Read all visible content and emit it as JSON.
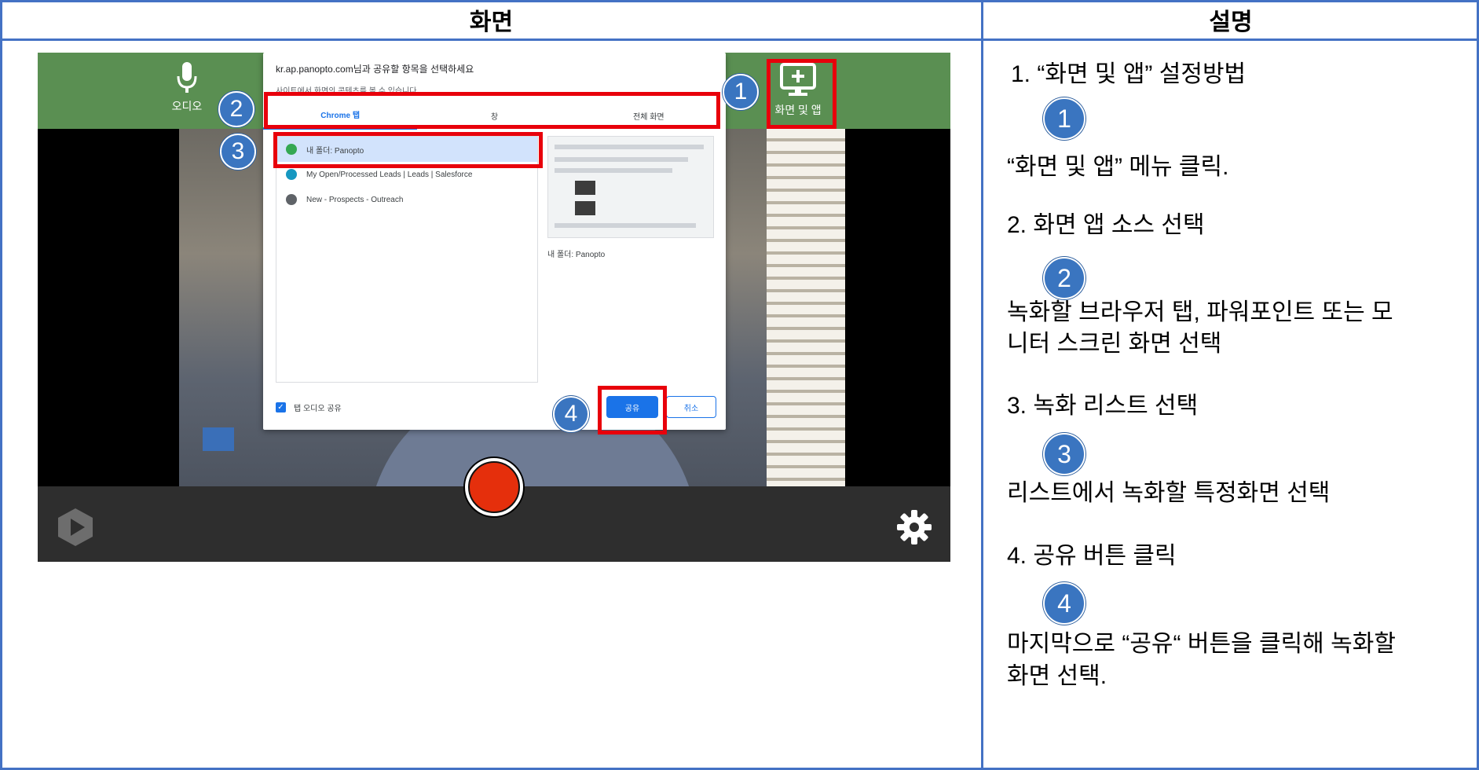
{
  "headers": {
    "left": "화면",
    "right": "설명"
  },
  "screen": {
    "audio_label": "오디오",
    "screen_app_label": "화면 및 앱",
    "dialog": {
      "title": "kr.ap.panopto.com님과 공유할 항목을 선택하세요",
      "subtitle": "사이트에서 화면의 콘텐츠를 볼 수 있습니다.",
      "tabs": [
        "Chrome 탭",
        "창",
        "전체 화면"
      ],
      "items": [
        {
          "label": "내 폴더: Panopto",
          "icon_color": "#34a853"
        },
        {
          "label": "My Open/Processed Leads | Leads | Salesforce",
          "icon_color": "#1798c1"
        },
        {
          "label": "New - Prospects - Outreach",
          "icon_color": "#5f6368"
        }
      ],
      "preview_caption": "내 폴더: Panopto",
      "checkbox_label": "탭 오디오 공유",
      "share_label": "공유",
      "cancel_label": "취소"
    }
  },
  "badges": [
    "1",
    "2",
    "3",
    "4"
  ],
  "description": {
    "step1_title": "1. “화면 및 앱” 설정방법",
    "step1_text": "“화면 및 앱” 메뉴 클릭.",
    "step2_title": "2. 화면 앱 소스 선택",
    "step2_text_line1": "녹화할 브라우저 탭, 파워포인트 또는 모",
    "step2_text_line2": "니터 스크린 화면 선택",
    "step3_title": "3. 녹화 리스트 선택",
    "step3_text": "리스트에서 녹화할 특정화면 선택",
    "step4_title": "4. 공유 버튼 클릭",
    "step4_text_line1": "마지막으로 “공유“ 버튼을 클릭해 녹화할",
    "step4_text_line2": "화면 선택."
  },
  "colors": {
    "accent_blue": "#4472c4",
    "highlight_red": "#e8000b",
    "badge_blue": "#3a75c0",
    "record_red": "#e52f0c"
  }
}
